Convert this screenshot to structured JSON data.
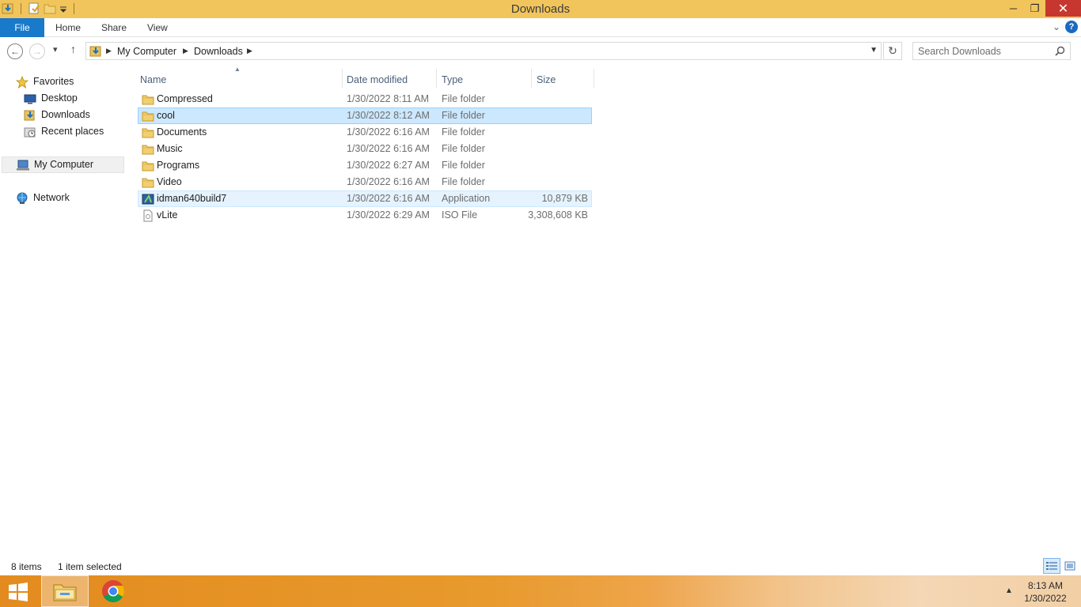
{
  "window": {
    "title": "Downloads",
    "minimize_label": "─",
    "restore_label": "❐",
    "close_label": "✕"
  },
  "ribbon": {
    "tabs": [
      "File",
      "Home",
      "Share",
      "View"
    ],
    "expand_label": "⌄",
    "help_label": "?"
  },
  "nav": {
    "back_label": "←",
    "forward_label": "→",
    "recent_label": "▾",
    "up_label": "↑",
    "breadcrumb": [
      "My Computer",
      "Downloads"
    ],
    "search_placeholder": "Search Downloads",
    "refresh_label": "↻"
  },
  "sidebar": {
    "favorites_label": "Favorites",
    "favorites": [
      "Desktop",
      "Downloads",
      "Recent places"
    ],
    "computer_label": "My Computer",
    "network_label": "Network"
  },
  "columns": {
    "name": "Name",
    "date": "Date modified",
    "type": "Type",
    "size": "Size"
  },
  "files": [
    {
      "name": "Compressed",
      "date": "1/30/2022 8:11 AM",
      "type": "File folder",
      "size": "",
      "icon": "folder-icon"
    },
    {
      "name": "cool",
      "date": "1/30/2022 8:12 AM",
      "type": "File folder",
      "size": "",
      "icon": "folder-icon"
    },
    {
      "name": "Documents",
      "date": "1/30/2022 6:16 AM",
      "type": "File folder",
      "size": "",
      "icon": "folder-icon"
    },
    {
      "name": "Music",
      "date": "1/30/2022 6:16 AM",
      "type": "File folder",
      "size": "",
      "icon": "folder-icon"
    },
    {
      "name": "Programs",
      "date": "1/30/2022 6:27 AM",
      "type": "File folder",
      "size": "",
      "icon": "folder-icon"
    },
    {
      "name": "Video",
      "date": "1/30/2022 6:16 AM",
      "type": "File folder",
      "size": "",
      "icon": "folder-icon"
    },
    {
      "name": "idman640build7",
      "date": "1/30/2022 6:16 AM",
      "type": "Application",
      "size": "10,879 KB",
      "icon": "application-icon"
    },
    {
      "name": "vLite",
      "date": "1/30/2022 6:29 AM",
      "type": "ISO File",
      "size": "3,308,608 KB",
      "icon": "iso-file-icon"
    }
  ],
  "status": {
    "items_count": "8 items",
    "selection": "1 item selected"
  },
  "taskbar": {
    "time": "8:13 AM",
    "date": "1/30/2022",
    "tray_label": "▲"
  },
  "colors": {
    "title_bar": "#f2c55c",
    "file_tab": "#1979ca",
    "selection": "#cce8ff",
    "close_button": "#c7372f"
  }
}
